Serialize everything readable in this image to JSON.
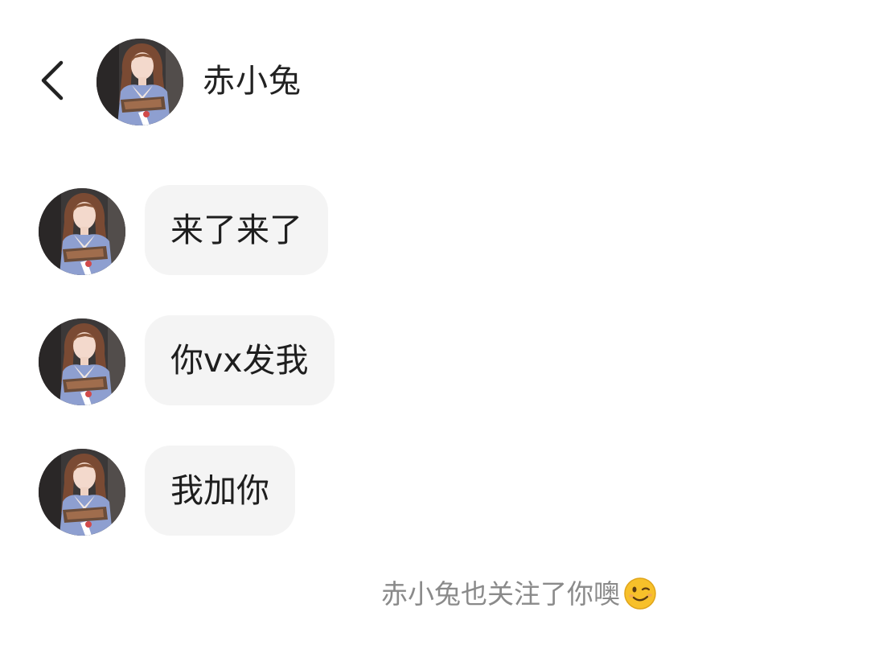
{
  "header": {
    "back_icon": "chevron-left-icon",
    "contact_name": "赤小兔",
    "avatar_icon": "contact-avatar-photo"
  },
  "messages": [
    {
      "sender": "赤小兔",
      "text": "来了来了"
    },
    {
      "sender": "赤小兔",
      "text": "你vx发我"
    },
    {
      "sender": "赤小兔",
      "text": "我加你"
    }
  ],
  "system_note": {
    "text": "赤小兔也关注了你噢",
    "emoji": "winking-face-emoji"
  },
  "colors": {
    "background": "#ffffff",
    "bubble": "#f4f4f4",
    "note_text": "#8a8a8a",
    "emoji": "#f7c02a"
  }
}
